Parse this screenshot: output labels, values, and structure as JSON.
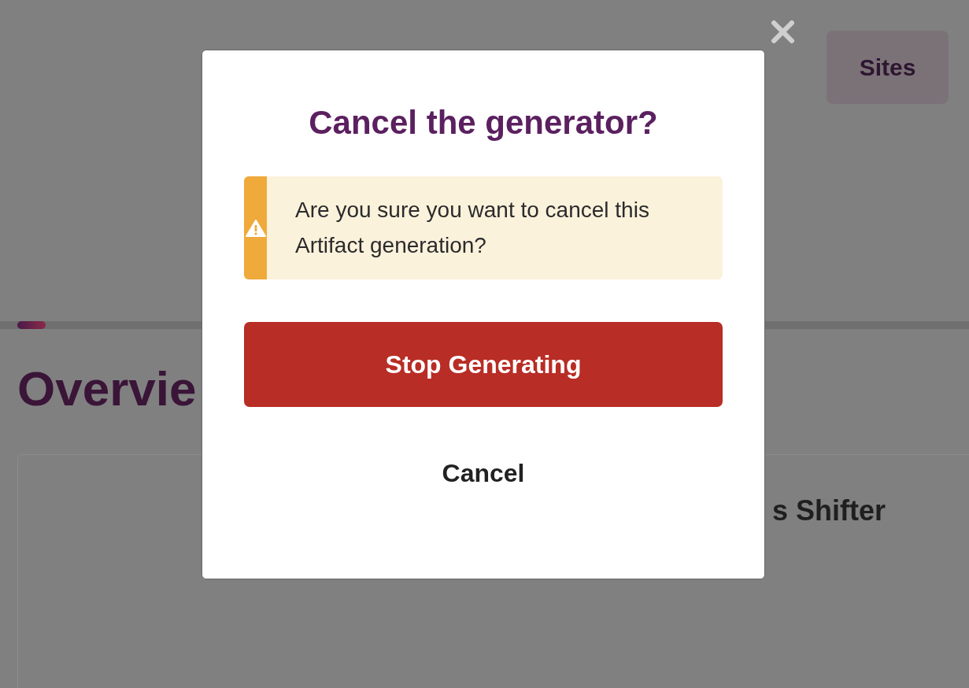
{
  "header": {
    "sites_button": "Sites"
  },
  "progress": {
    "level": 0.03
  },
  "page": {
    "heading": "Overvie",
    "card_title": "s Shifter"
  },
  "dialog": {
    "title": "Cancel the generator?",
    "alert": {
      "kind": "warning",
      "text": "Are you sure you want to cancel this Artifact generation?"
    },
    "confirm_button": "Stop Generating",
    "cancel_button": "Cancel"
  }
}
